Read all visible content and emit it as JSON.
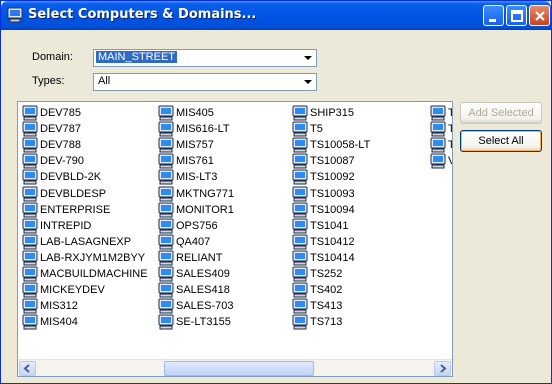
{
  "window": {
    "title": "Select Computers & Domains..."
  },
  "domain": {
    "label": "Domain:",
    "value": "MAIN_STREET"
  },
  "types": {
    "label": "Types:",
    "value": "All"
  },
  "buttons": {
    "add_selected": "Add Selected",
    "select_all": "Select All"
  },
  "columns": [
    [
      "DEV785",
      "DEV787",
      "DEV788",
      "DEV-790",
      "DEVBLD-2K",
      "DEVBLDESP",
      "ENTERPRISE",
      "INTREPID",
      "LAB-LASAGNEXP",
      "LAB-RXJYM1M2BYY",
      "MACBUILDMACHINE",
      "MICKEYDEV",
      "MIS312",
      "MIS404"
    ],
    [
      "MIS405",
      "MIS616-LT",
      "MIS757",
      "MIS761",
      "MIS-LT3",
      "MKTNG771",
      "MONITOR1",
      "OPS756",
      "QA407",
      "RELIANT",
      "SALES409",
      "SALES418",
      "SALES-703",
      "SE-LT3155"
    ],
    [
      "SHIP315",
      "T5",
      "TS10058-LT",
      "TS10087",
      "TS10092",
      "TS10093",
      "TS10094",
      "TS1041",
      "TS10412",
      "TS10414",
      "TS252",
      "TS402",
      "TS413",
      "TS713"
    ],
    [
      "T",
      "T",
      "T",
      "V"
    ]
  ],
  "icons": {
    "item": "computer-icon"
  }
}
